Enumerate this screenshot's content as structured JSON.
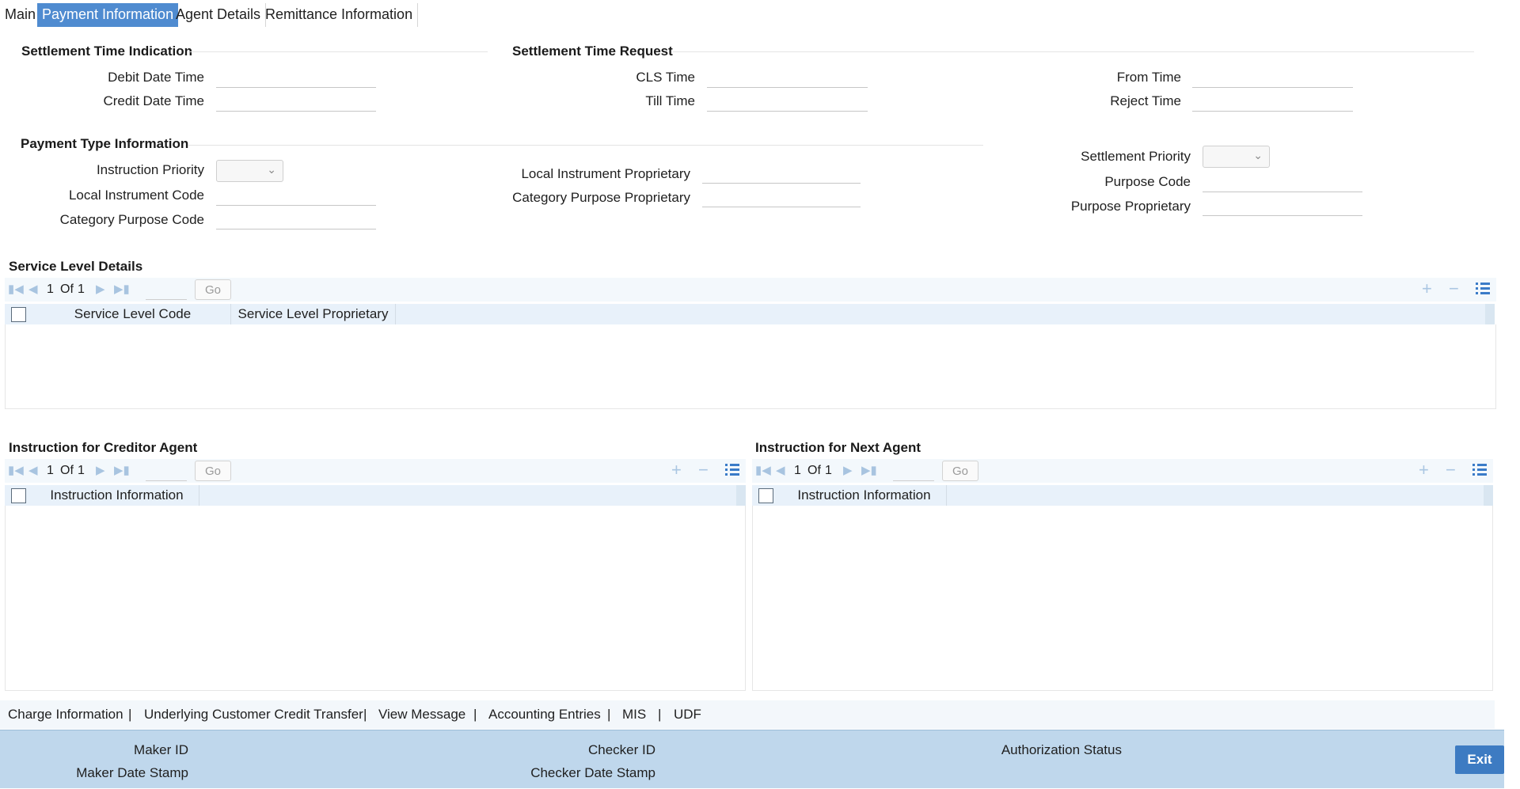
{
  "tabs": [
    "Main",
    "Payment Information",
    "Agent Details",
    "Remittance Information"
  ],
  "settlement_time_indication": {
    "title": "Settlement Time Indication",
    "debit_date_time_label": "Debit Date Time",
    "credit_date_time_label": "Credit Date Time"
  },
  "settlement_time_request": {
    "title": "Settlement Time Request",
    "cls_time_label": "CLS Time",
    "till_time_label": "Till Time",
    "from_time_label": "From Time",
    "reject_time_label": "Reject Time"
  },
  "payment_type_information": {
    "title": "Payment Type Information",
    "instruction_priority_label": "Instruction Priority",
    "local_instrument_code_label": "Local Instrument Code",
    "category_purpose_code_label": "Category Purpose Code",
    "local_instrument_proprietary_label": "Local Instrument Proprietary",
    "category_purpose_proprietary_label": "Category Purpose Proprietary",
    "settlement_priority_label": "Settlement Priority",
    "purpose_code_label": "Purpose Code",
    "purpose_proprietary_label": "Purpose Proprietary"
  },
  "service_level_details": {
    "title": "Service Level Details",
    "page": "1",
    "of_label": "Of",
    "total": "1",
    "go_label": "Go",
    "columns": [
      "Service Level Code",
      "Service Level Proprietary"
    ]
  },
  "creditor_agent": {
    "title": "Instruction for Creditor Agent",
    "page": "1",
    "of_label": "Of",
    "total": "1",
    "go_label": "Go",
    "columns": [
      "Instruction Information"
    ]
  },
  "next_agent": {
    "title": "Instruction for Next Agent",
    "page": "1",
    "of_label": "Of",
    "total": "1",
    "go_label": "Go",
    "columns": [
      "Instruction Information"
    ]
  },
  "links": [
    "Charge Information",
    "Underlying Customer Credit Transfer",
    "View Message",
    "Accounting Entries",
    "MIS",
    "UDF"
  ],
  "link_separator": "|",
  "footer": {
    "maker_id_label": "Maker ID",
    "maker_date_stamp_label": "Maker Date Stamp",
    "checker_id_label": "Checker ID",
    "checker_date_stamp_label": "Checker Date Stamp",
    "authorization_status_label": "Authorization Status",
    "exit_label": "Exit"
  },
  "colors": {
    "active_tab": "#4f8bd0",
    "footer_bg": "#bfd7ec",
    "exit_button": "#3d7bc2",
    "grid_header": "#e8f1fa"
  }
}
